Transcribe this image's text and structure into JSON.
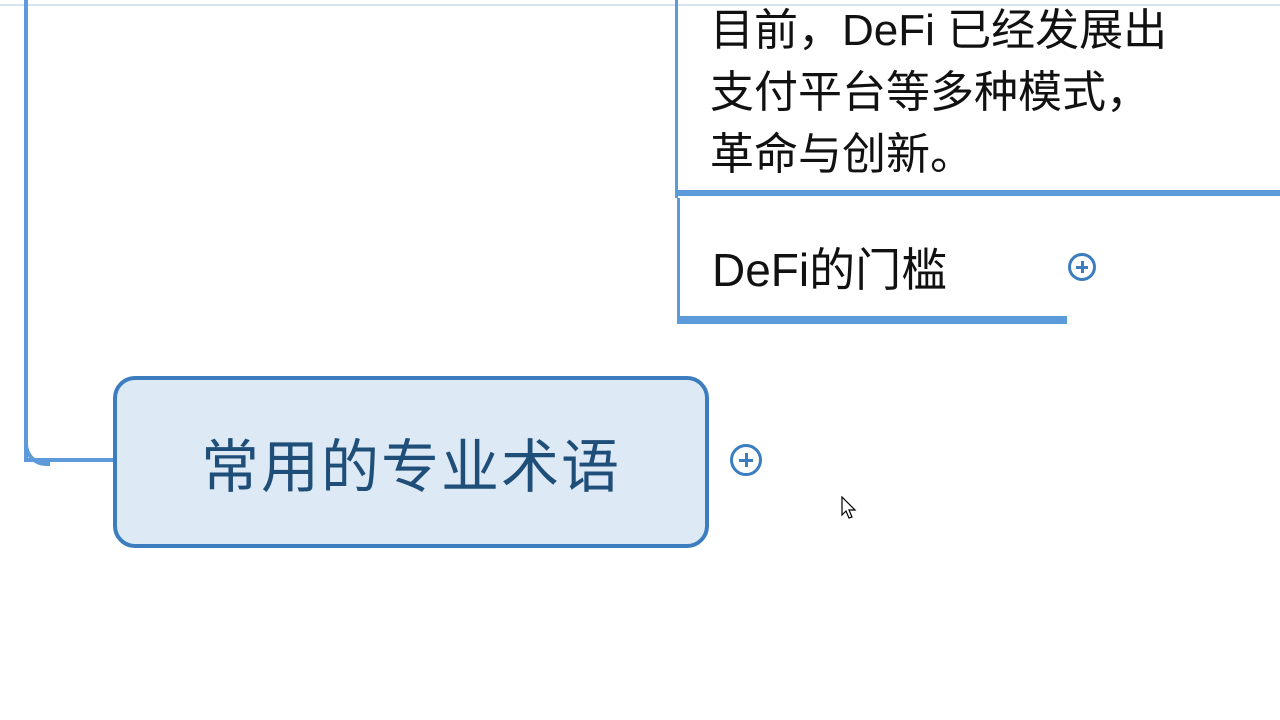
{
  "detail": {
    "line1": "目前，DeFi 已经发展出",
    "line2": "支付平台等多种模式，",
    "line3": "革命与创新。"
  },
  "child": {
    "title": "DeFi的门槛"
  },
  "selected": {
    "title": "常用的专业术语"
  }
}
